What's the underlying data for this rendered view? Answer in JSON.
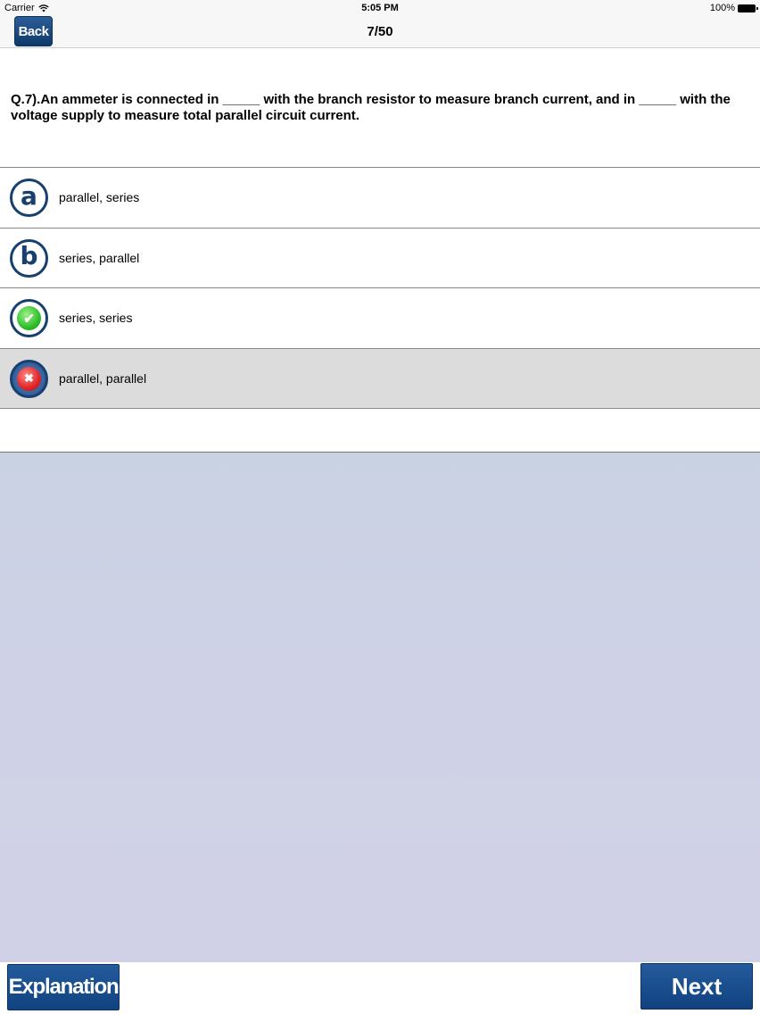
{
  "status_bar": {
    "carrier": "Carrier",
    "time": "5:05 PM",
    "battery": "100%",
    "wifi_icon": "wifi-icon",
    "battery_icon": "battery-icon"
  },
  "nav": {
    "back_label": "Back",
    "title": "7/50"
  },
  "question": {
    "text": "Q.7).An ammeter is connected in _____ with the branch resistor to measure branch current, and in _____ with the voltage supply to measure total parallel circuit current."
  },
  "options": [
    {
      "badge": "a",
      "label": "parallel, series",
      "state": "normal"
    },
    {
      "badge": "b",
      "label": "series, parallel",
      "state": "normal"
    },
    {
      "badge": "check-icon",
      "label": "series, series",
      "state": "correct"
    },
    {
      "badge": "x-icon",
      "label": "parallel, parallel",
      "state": "wrong-selected"
    }
  ],
  "footer": {
    "explanation_label": "Explanation",
    "next_label": "Next"
  },
  "colors": {
    "button_blue": "#11427f",
    "badge_ring": "#17406f",
    "correct_green": "#2fbf2a",
    "wrong_red": "#e02525",
    "selected_row": "#dcdcdc",
    "content_bg": "#cfd2e6"
  }
}
